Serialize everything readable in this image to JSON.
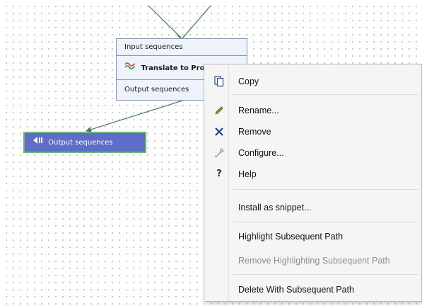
{
  "workflow_element": {
    "input_label": "Input sequences",
    "title": "Translate to Protein",
    "output_label": "Output sequences"
  },
  "output_node": {
    "label": "Output sequences",
    "color": "#5e6ec8",
    "border_color": "#5fc06a"
  },
  "context_menu": {
    "items": {
      "copy": {
        "label": "Copy",
        "icon": "copy-icon"
      },
      "rename": {
        "label": "Rename...",
        "icon": "pencil-icon"
      },
      "remove": {
        "label": "Remove",
        "icon": "remove-x-icon"
      },
      "configure": {
        "label": "Configure...",
        "icon": "wrench-icon"
      },
      "help": {
        "label": "Help",
        "icon": "help-question-icon"
      },
      "install_snippet": {
        "label": "Install as snippet..."
      },
      "highlight_path": {
        "label": "Highlight Subsequent Path"
      },
      "remove_highlighting": {
        "label": "Remove Highlighting Subsequent Path",
        "disabled": true
      },
      "delete_path": {
        "label": "Delete With Subsequent Path"
      }
    }
  },
  "colors": {
    "node_border": "#7d99c4",
    "node_background": "#eef3fb",
    "connector": "#3d7a5a",
    "remove_icon": "#1f3f9c"
  }
}
